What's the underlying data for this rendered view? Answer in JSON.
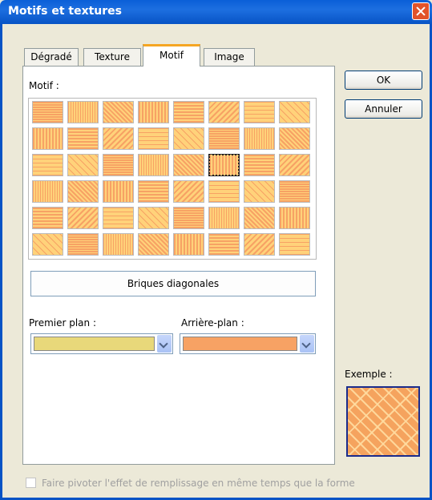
{
  "window": {
    "title": "Motifs et textures"
  },
  "tabs": [
    {
      "label": "Dégradé"
    },
    {
      "label": "Texture"
    },
    {
      "label": "Motif"
    },
    {
      "label": "Image"
    }
  ],
  "active_tab": "Motif",
  "pattern_section_label": "Motif :",
  "patterns": {
    "rows": 6,
    "cols": 8,
    "selected_row": 2,
    "selected_col": 5,
    "selected_name": "Briques diagonales"
  },
  "foreground": {
    "label": "Premier plan :",
    "color": "#e8d87a"
  },
  "background": {
    "label": "Arrière-plan :",
    "color": "#f7a264"
  },
  "buttons": {
    "ok": "OK",
    "cancel": "Annuler"
  },
  "example_label": "Exemple :",
  "rotate_checkbox": {
    "label": "Faire pivoter l'effet de remplissage en même temps que la forme",
    "checked": false,
    "enabled": false
  },
  "colors": {
    "titlebar": "#0a5fd8",
    "pattern_fg": "#f7a264",
    "pattern_bg": "#ffd27a"
  }
}
